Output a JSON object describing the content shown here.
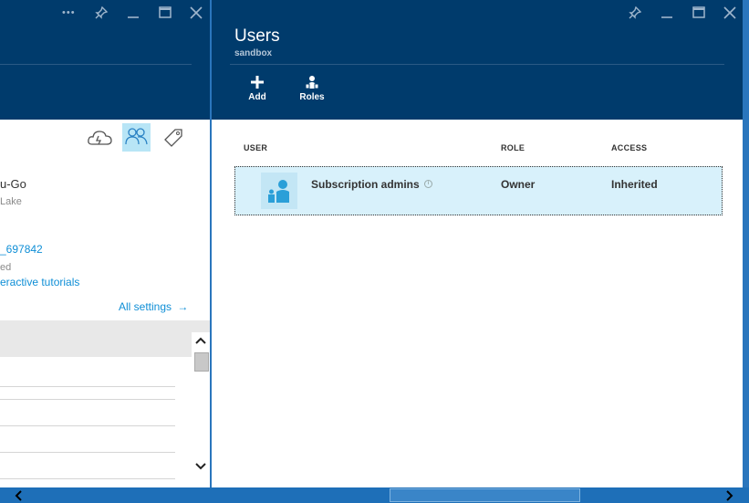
{
  "left_blade": {
    "title_fragment": "u-Go",
    "location_fragment": "Lake",
    "id_link_fragment": "_697842",
    "status_fragment": "ed",
    "tutorials_link_fragment": "eractive tutorials",
    "all_settings_label": "All settings",
    "all_settings_arrow": "→"
  },
  "right_blade": {
    "title": "Users",
    "subtitle": "sandbox",
    "commands": [
      {
        "label": "Add",
        "icon": "plus-icon"
      },
      {
        "label": "Roles",
        "icon": "roles-icon"
      }
    ],
    "table": {
      "headers": [
        "USER",
        "ROLE",
        "ACCESS"
      ],
      "rows": [
        {
          "user": "Subscription admins",
          "role": "Owner",
          "access": "Inherited",
          "selected": true
        }
      ]
    }
  },
  "window_controls": {
    "more": "•••",
    "pin": "📌",
    "minimize": "—",
    "maximize": "□",
    "close": "✕"
  },
  "colors": {
    "header_bg": "#003b6c",
    "accent_link": "#0e8ed6",
    "selected_row_bg": "#d8f1fb",
    "bottom_bar": "#1e6fb8"
  }
}
